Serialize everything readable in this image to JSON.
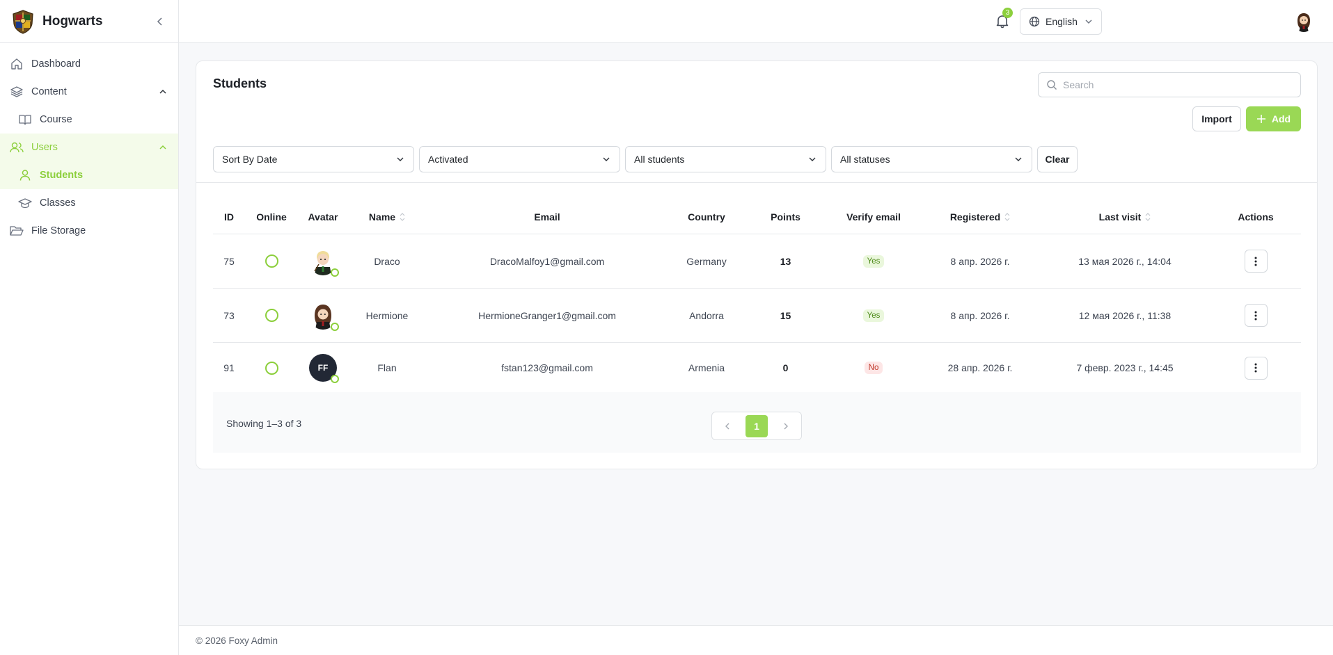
{
  "brand": {
    "name": "Hogwarts"
  },
  "sidebar": {
    "items": [
      {
        "label": "Dashboard"
      },
      {
        "label": "Content"
      },
      {
        "label": "Course"
      },
      {
        "label": "Users"
      },
      {
        "label": "Students"
      },
      {
        "label": "Classes"
      },
      {
        "label": "File Storage"
      }
    ]
  },
  "topbar": {
    "notifications_count": "3",
    "language": "English"
  },
  "page": {
    "title": "Students",
    "search_placeholder": "Search",
    "import_label": "Import",
    "add_label": "Add",
    "clear_label": "Clear",
    "filters": [
      "Sort By Date",
      "Activated",
      "All students",
      "All statuses"
    ]
  },
  "table": {
    "headers": {
      "id": "ID",
      "online": "Online",
      "avatar": "Avatar",
      "name": "Name",
      "email": "Email",
      "country": "Country",
      "points": "Points",
      "verify": "Verify email",
      "registered": "Registered",
      "last_visit": "Last visit",
      "actions": "Actions"
    },
    "rows": [
      {
        "id": "75",
        "name": "Draco",
        "email": "DracoMalfoy1@gmail.com",
        "country": "Germany",
        "points": "13",
        "verify": "Yes",
        "registered": "8 апр. 2026 г.",
        "last_visit": "13 мая 2026 г., 14:04"
      },
      {
        "id": "73",
        "name": "Hermione",
        "email": "HermioneGranger1@gmail.com",
        "country": "Andorra",
        "points": "15",
        "verify": "Yes",
        "registered": "8 апр. 2026 г.",
        "last_visit": "12 мая 2026 г., 11:38"
      },
      {
        "id": "91",
        "name": "Flan",
        "initials": "FF",
        "email": "fstan123@gmail.com",
        "country": "Armenia",
        "points": "0",
        "verify": "No",
        "registered": "28 апр. 2026 г.",
        "last_visit": "7 февр. 2023 г., 14:45"
      }
    ]
  },
  "pagination": {
    "showing": "Showing 1–3 of 3",
    "current_page": "1"
  },
  "footer": {
    "text": "© 2026 Foxy Admin"
  },
  "colors": {
    "accent": "#8ccf3c",
    "accent_button": "#9ad855",
    "yes_bg": "#eaf7dc",
    "no_bg": "#fde6e6"
  }
}
